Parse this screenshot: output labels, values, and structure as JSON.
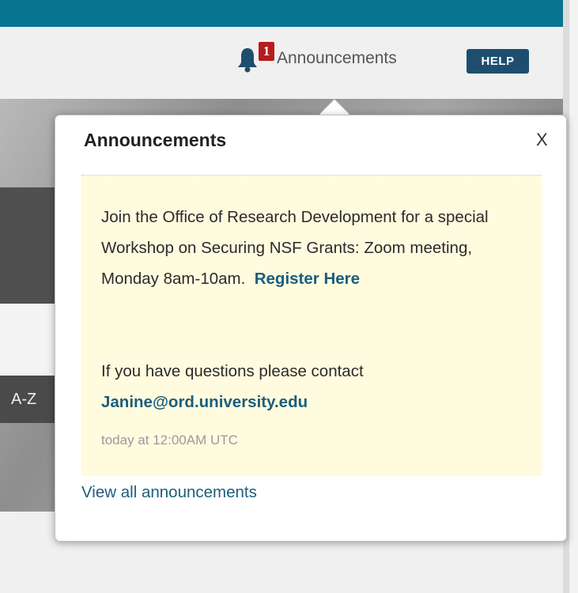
{
  "header": {
    "announcements_label": "Announcements",
    "badge_count": "1",
    "help_label": "HELP"
  },
  "sidebar": {
    "az_label": "A-Z"
  },
  "popover": {
    "title": "Announcements",
    "close_label": "X",
    "announcement": {
      "message": "Join the Office of Research Development for a special Workshop on Securing NSF Grants: Zoom meeting, Monday 8am-10am.",
      "register_link": "Register Here",
      "contact_text": "If you have questions please contact",
      "email": "Janine@ord.university.edu",
      "timestamp": "today at 12:00AM UTC"
    },
    "view_all_label": "View all announcements"
  },
  "icons": {
    "bell": "bell-icon"
  },
  "colors": {
    "topbar": "#0a7591",
    "help_button": "#1d4e6e",
    "badge": "#b71c1c",
    "link": "#1d5d7c",
    "announcement_bg": "#fefbdf"
  }
}
